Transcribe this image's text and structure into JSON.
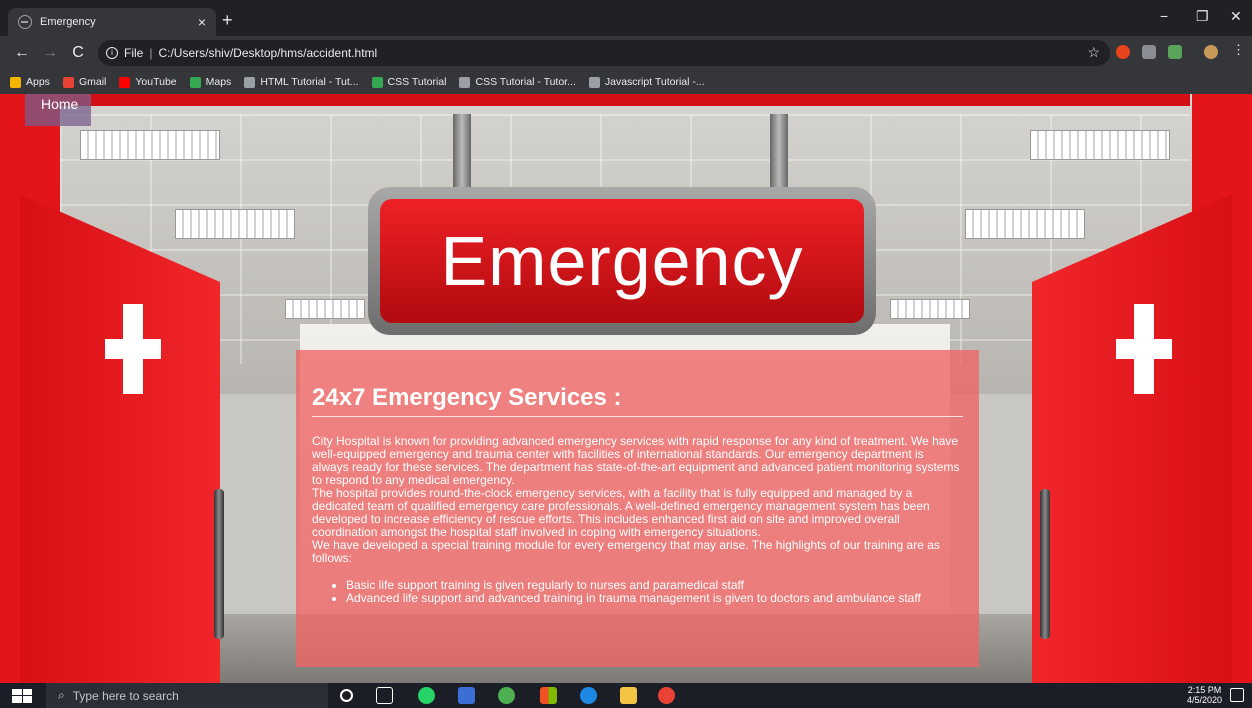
{
  "browser": {
    "tab_title": "Emergency",
    "tab_close": "×",
    "new_tab": "+",
    "window_controls": {
      "minimize": "−",
      "maximize": "❐",
      "close": "✕"
    },
    "nav": {
      "back": "←",
      "forward": "→",
      "reload": "C"
    },
    "omnibox": {
      "scheme_label": "File",
      "url": "C:/Users/shiv/Desktop/hms/accident.html"
    },
    "bookmarks": [
      {
        "label": "Apps",
        "color": "#f4b400"
      },
      {
        "label": "Gmail",
        "color": "#ea4335"
      },
      {
        "label": "YouTube",
        "color": "#ff0000"
      },
      {
        "label": "Maps",
        "color": "#34a853"
      },
      {
        "label": "HTML Tutorial - Tut...",
        "color": "#9aa0a6"
      },
      {
        "label": "CSS Tutorial",
        "color": "#34a853"
      },
      {
        "label": "CSS Tutorial - Tutor...",
        "color": "#9aa0a6"
      },
      {
        "label": "Javascript Tutorial -...",
        "color": "#9aa0a6"
      }
    ]
  },
  "page": {
    "home_link": "Home",
    "sign_text": "Emergency",
    "heading": "24x7 Emergency Services :",
    "paragraph": "City Hospital is known for providing advanced emergency services with rapid response for any kind of treatment. We have well-equipped emergency and trauma center with facilities of international standards. Our emergency department is always ready for these services. The department has state-of-the-art equipment and advanced patient monitoring systems to respond to any medical emergency.\nThe hospital provides round-the-clock emergency services, with a facility that is fully equipped and managed by a dedicated team of qualified emergency care professionals. A well-defined emergency management system has been developed to increase efficiency of rescue efforts. This includes enhanced first aid on site and improved overall coordination amongst the hospital staff involved in coping with emergency situations.\nWe have developed a special training module for every emergency that may arise. The highlights of our training are as follows:",
    "list": [
      "Basic life support training is given regularly to nurses and paramedical staff",
      "Advanced life support and advanced training in trauma management is given to doctors and ambulance staff"
    ]
  },
  "taskbar": {
    "search_placeholder": "Type here to search",
    "time": "2:15 PM",
    "date": "4/5/2020"
  },
  "colors": {
    "accent_red": "#e4151a",
    "panel": "#f06464"
  }
}
